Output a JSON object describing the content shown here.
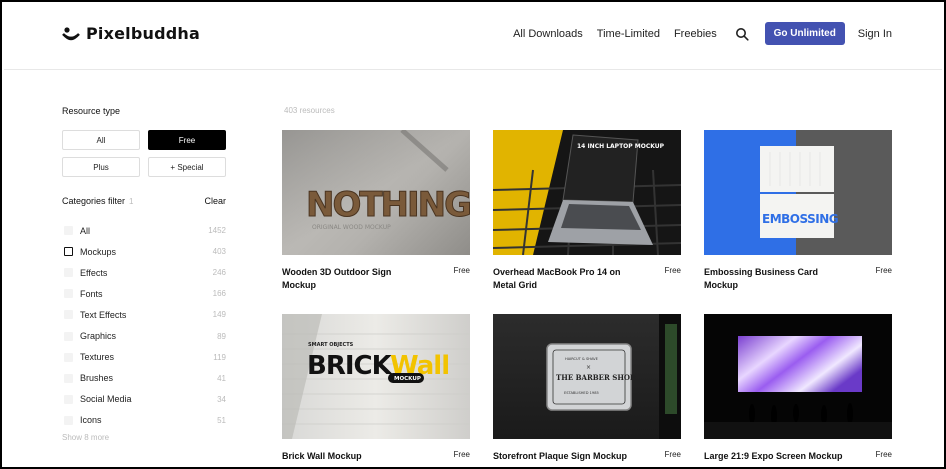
{
  "brand": {
    "name": "Pixelbuddha"
  },
  "nav": {
    "links": [
      "All Downloads",
      "Time-Limited",
      "Freebies"
    ],
    "search_icon": "search-icon",
    "cta": "Go Unlimited",
    "signin": "Sign In"
  },
  "colors": {
    "accent": "#4352b1",
    "active_filter": "#000000",
    "thumb_blue": "#2f6fe6"
  },
  "sidebar": {
    "resource_type_title": "Resource type",
    "types": [
      {
        "label": "All",
        "active": false
      },
      {
        "label": "Free",
        "active": true
      },
      {
        "label": "Plus",
        "active": false
      },
      {
        "label": "+ Special",
        "active": false
      }
    ],
    "categories_title": "Categories filter",
    "categories_count": "1",
    "clear_label": "Clear",
    "categories": [
      {
        "label": "All",
        "count": "1452",
        "checked": false
      },
      {
        "label": "Mockups",
        "count": "403",
        "checked": true
      },
      {
        "label": "Effects",
        "count": "246",
        "checked": false
      },
      {
        "label": "Fonts",
        "count": "166",
        "checked": false
      },
      {
        "label": "Text Effects",
        "count": "149",
        "checked": false
      },
      {
        "label": "Graphics",
        "count": "89",
        "checked": false
      },
      {
        "label": "Textures",
        "count": "119",
        "checked": false
      },
      {
        "label": "Brushes",
        "count": "41",
        "checked": false
      },
      {
        "label": "Social Media",
        "count": "34",
        "checked": false
      },
      {
        "label": "Icons",
        "count": "51",
        "checked": false
      }
    ],
    "show_more": "Show 8 more"
  },
  "main": {
    "resources_count": "403 resources",
    "cards": [
      {
        "title": "Wooden 3D Outdoor Sign Mockup",
        "price": "Free",
        "thumb_text": "NOTHING",
        "thumb_sub": "ORIGINAL WOOD MOCKUP"
      },
      {
        "title": "Overhead MacBook Pro 14 on Metal Grid",
        "price": "Free",
        "thumb_text": "14 INCH LAPTOP MOCKUP"
      },
      {
        "title": "Embossing Business Card Mockup",
        "price": "Free",
        "thumb_text": "EMBOSSING"
      },
      {
        "title": "Brick Wall Mockup",
        "price": "Free",
        "thumb_text": "BRICK",
        "thumb_text2": "Wall",
        "thumb_badge": "MOCKUP",
        "thumb_small": "SMART OBJECTS"
      },
      {
        "title": "Storefront Plaque Sign Mockup",
        "price": "Free",
        "thumb_text": "THE BARBER SHOP",
        "thumb_top": "HAIRCUT & SHAVE",
        "thumb_bottom": "ESTABLISHED 1985"
      },
      {
        "title": "Large 21:9 Expo Screen Mockup",
        "price": "Free",
        "thumb_text": ""
      }
    ]
  }
}
